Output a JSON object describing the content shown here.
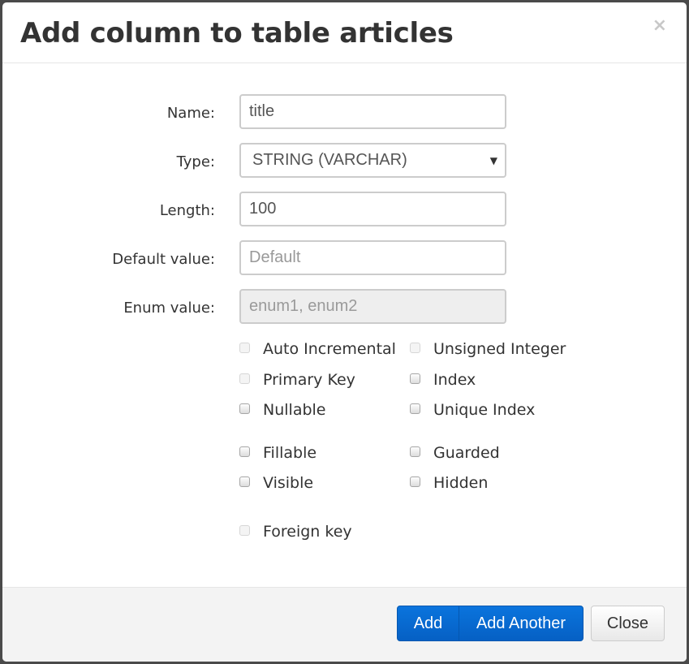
{
  "modal": {
    "title": "Add column to table articles",
    "close_glyph": "×"
  },
  "form": {
    "name": {
      "label": "Name:",
      "value": "title"
    },
    "type": {
      "label": "Type:",
      "value": "STRING (VARCHAR)",
      "caret": "▼"
    },
    "length": {
      "label": "Length:",
      "value": "100"
    },
    "default": {
      "label": "Default value:",
      "placeholder": "Default"
    },
    "enum": {
      "label": "Enum value:",
      "placeholder": "enum1, enum2"
    }
  },
  "checkboxes": {
    "auto_incremental": {
      "label": "Auto Incremental",
      "checked": false,
      "disabled": true
    },
    "unsigned_integer": {
      "label": "Unsigned Integer",
      "checked": false,
      "disabled": true
    },
    "primary_key": {
      "label": "Primary Key",
      "checked": false,
      "disabled": true
    },
    "index": {
      "label": "Index",
      "checked": false,
      "disabled": false
    },
    "nullable": {
      "label": "Nullable",
      "checked": false,
      "disabled": false
    },
    "unique_index": {
      "label": "Unique Index",
      "checked": false,
      "disabled": false
    },
    "fillable": {
      "label": "Fillable",
      "checked": false,
      "disabled": false
    },
    "guarded": {
      "label": "Guarded",
      "checked": false,
      "disabled": false
    },
    "visible": {
      "label": "Visible",
      "checked": false,
      "disabled": false
    },
    "hidden": {
      "label": "Hidden",
      "checked": false,
      "disabled": false
    },
    "foreign_key": {
      "label": "Foreign key",
      "checked": false,
      "disabled": true
    }
  },
  "footer": {
    "add_label": "Add",
    "add_another_label": "Add Another",
    "close_label": "Close"
  },
  "colors": {
    "primary": "#0a6ad6",
    "overlay": "#4a4a4a",
    "footer_bg": "#f3f3f3"
  }
}
